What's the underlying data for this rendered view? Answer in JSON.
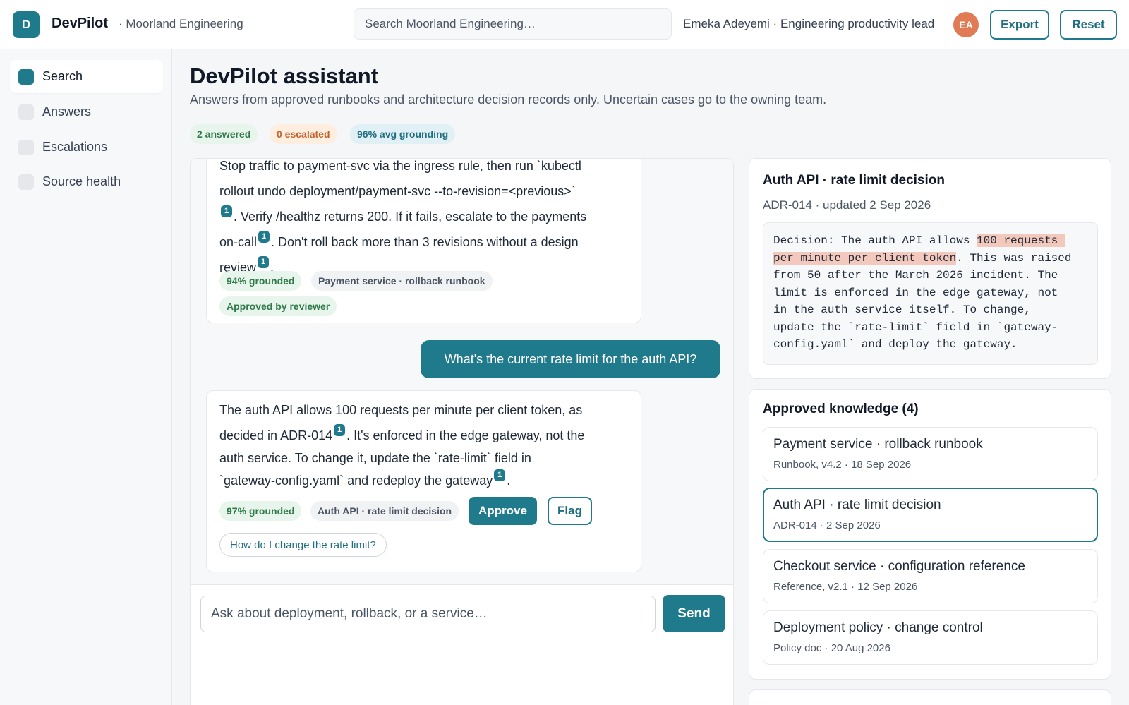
{
  "header": {
    "logo_letter": "D",
    "app_name": "DevPilot",
    "org": "· Moorland Engineering",
    "search_placeholder": "Search Moorland Engineering…",
    "user": "Emeka Adeyemi · Engineering productivity lead",
    "avatar_initials": "EA",
    "export_label": "Export",
    "reset_label": "Reset"
  },
  "sidebar": {
    "items": [
      {
        "label": "Search",
        "active": true
      },
      {
        "label": "Answers",
        "active": false
      },
      {
        "label": "Escalations",
        "active": false
      },
      {
        "label": "Source health",
        "active": false
      }
    ]
  },
  "main": {
    "title": "DevPilot assistant",
    "subtitle": "Answers from approved runbooks and architecture decision records only. Uncertain cases go to the owning team.",
    "stats": {
      "answered": "2 answered",
      "escalated": "0 escalated",
      "grounding": "96% avg grounding"
    }
  },
  "chat": {
    "messages": [
      {
        "role": "assistant",
        "lines": [
          "Stop traffic to payment-svc via the ingress rule, then run `kubectl",
          "rollout undo deployment/payment-svc --to-revision=<previous>`",
          ". Verify /healthz returns 200. If it fails, escalate to the payments",
          "on-call",
          ". Don't roll back more than 3 revisions without a design",
          "review",
          "."
        ],
        "citation": "1",
        "grounded": "94% grounded",
        "source": "Payment service · rollback runbook",
        "status": "Approved by reviewer"
      },
      {
        "role": "user",
        "text": "What's the current rate limit for the auth API?"
      },
      {
        "role": "assistant",
        "lines": [
          "The auth API allows 100 requests per minute per client token, as",
          "decided in ADR-014",
          ". It's enforced in the edge gateway, not the",
          "auth service. To change it, update the `rate-limit` field in",
          "`gateway-config.yaml` and redeploy the gateway",
          "."
        ],
        "citation": "1",
        "grounded": "97% grounded",
        "source": "Auth API · rate limit decision",
        "approve_label": "Approve",
        "flag_label": "Flag",
        "follow_up": "How do I change the rate limit?"
      }
    ],
    "input_placeholder": "Ask about deployment, rollback, or a service…",
    "send_label": "Send"
  },
  "doc": {
    "title": "Auth API · rate limit decision",
    "meta": "ADR-014 · updated 2 Sep 2026",
    "code_prefix": "Decision: The auth API allows ",
    "code_highlight_1": "100 requests ",
    "code_highlight_2": "per minute per client token",
    "code_lines": [
      ". This was raised",
      "from 50 after the March 2026 incident. The",
      "limit is enforced in the edge gateway, not",
      "in the auth service itself. To change,",
      "update the `rate-limit` field in `gateway-",
      "config.yaml` and deploy the gateway."
    ]
  },
  "knowledge": {
    "title": "Approved knowledge (4)",
    "items": [
      {
        "name": "Payment service · rollback runbook",
        "meta": "Runbook, v4.2 · 18 Sep 2026",
        "selected": false
      },
      {
        "name": "Auth API · rate limit decision",
        "meta": "ADR-014 · 2 Sep 2026",
        "selected": true
      },
      {
        "name": "Checkout service · configuration reference",
        "meta": "Reference, v2.1 · 12 Sep 2026",
        "selected": false
      },
      {
        "name": "Deployment policy · change control",
        "meta": "Policy doc · 20 Aug 2026",
        "selected": false
      }
    ]
  },
  "colors": {
    "accent": "#1f7a8c",
    "avatar": "#e07b55",
    "highlight": "#f3c9bd",
    "green_badge_bg": "#e7f5ec",
    "orange_badge_bg": "#fdeee0"
  }
}
